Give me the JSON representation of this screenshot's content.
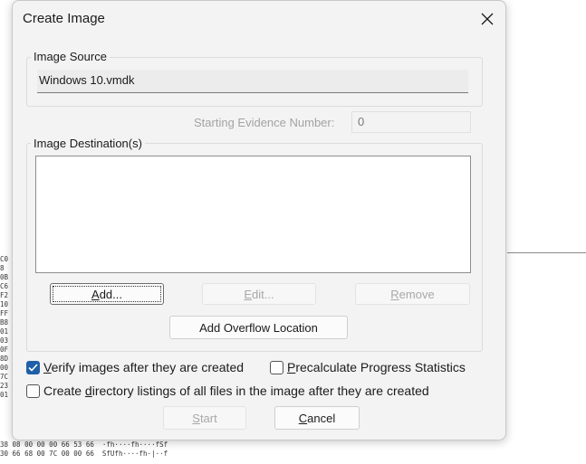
{
  "background": {
    "hex_left_lines": [
      "C0",
      "8",
      "0B",
      "C6",
      "F2",
      "10",
      "FF",
      "B8",
      "01",
      "03",
      "0F",
      "8D",
      "00",
      "7C",
      "23",
      "01"
    ],
    "hex_bottom_lines": [
      "38 08 00 00 00 66 53 66  ·fh····fh····fSf",
      "30 66 68 00 7C 00 00 66  SfUfh····fh·|··f"
    ]
  },
  "dialog": {
    "title": "Create Image",
    "close_icon": "close-icon",
    "image_source": {
      "label": "Image Source",
      "value": "Windows 10.vmdk"
    },
    "starting_evidence": {
      "label": "Starting Evidence Number:",
      "value": "0"
    },
    "image_destination": {
      "label": "Image Destination(s)",
      "items": []
    },
    "buttons": {
      "add": {
        "pre": "",
        "mnemonic": "A",
        "post": "dd..."
      },
      "edit": {
        "pre": "",
        "mnemonic": "E",
        "post": "dit..."
      },
      "remove": {
        "pre": "",
        "mnemonic": "R",
        "post": "emove"
      },
      "add_overflow": "Add Overflow Location",
      "start": {
        "pre": "",
        "mnemonic": "S",
        "post": "tart"
      },
      "cancel": {
        "pre": "",
        "mnemonic": "C",
        "post": "ancel"
      }
    },
    "checkboxes": {
      "verify": {
        "pre": "",
        "mnemonic": "V",
        "post": "erify images after they are created",
        "checked": true
      },
      "precalc": {
        "pre": "",
        "mnemonic": "P",
        "post": "recalculate Progress Statistics",
        "checked": false
      },
      "dir_listings": {
        "pre": "Create ",
        "mnemonic": "d",
        "post": "irectory listings of all files in the image after they are created",
        "checked": false
      }
    },
    "colors": {
      "accent": "#1f5fa8",
      "disabled_text": "#a8a8a8"
    }
  }
}
